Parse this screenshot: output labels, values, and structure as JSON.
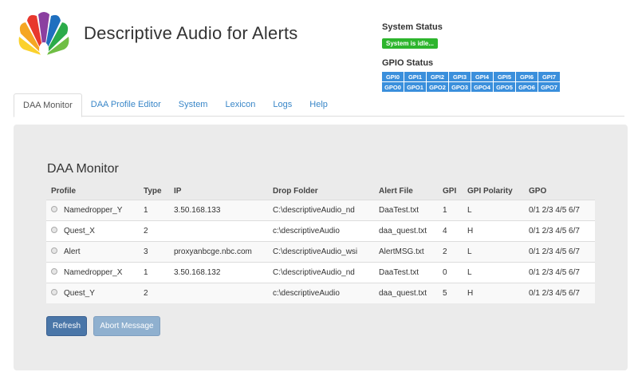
{
  "header": {
    "title": "Descriptive Audio for Alerts",
    "logo_icon": "peacock-logo"
  },
  "system_status": {
    "heading": "System Status",
    "value": "System is idle...",
    "color": "#2db52d"
  },
  "gpio_status": {
    "heading": "GPIO Status",
    "gpi": [
      "GPI0",
      "GPI1",
      "GPI2",
      "GPI3",
      "GPI4",
      "GPI5",
      "GPI6",
      "GPI7"
    ],
    "gpo": [
      "GPO0",
      "GPO1",
      "GPO2",
      "GPO3",
      "GPO4",
      "GPO5",
      "GPO6",
      "GPO7"
    ],
    "color": "#3a8fdc"
  },
  "tabs": [
    {
      "label": "DAA Monitor",
      "active": true
    },
    {
      "label": "DAA Profile Editor",
      "active": false
    },
    {
      "label": "System",
      "active": false
    },
    {
      "label": "Lexicon",
      "active": false
    },
    {
      "label": "Logs",
      "active": false
    },
    {
      "label": "Help",
      "active": false
    }
  ],
  "monitor": {
    "title": "DAA Monitor",
    "columns": [
      "Profile",
      "Type",
      "IP",
      "Drop Folder",
      "Alert File",
      "GPI",
      "GPI Polarity",
      "GPO"
    ],
    "rows": [
      [
        "Namedropper_Y",
        "1",
        "3.50.168.133",
        "C:\\descriptiveAudio_nd",
        "DaaTest.txt",
        "1",
        "L",
        "0/1 2/3 4/5 6/7"
      ],
      [
        "Quest_X",
        "2",
        "",
        "c:\\descriptiveAudio",
        "daa_quest.txt",
        "4",
        "H",
        "0/1 2/3 4/5 6/7"
      ],
      [
        "Alert",
        "3",
        "proxyanbcge.nbc.com",
        "C:\\descriptiveAudio_wsi",
        "AlertMSG.txt",
        "2",
        "L",
        "0/1 2/3 4/5 6/7"
      ],
      [
        "Namedropper_X",
        "1",
        "3.50.168.132",
        "C:\\descriptiveAudio_nd",
        "DaaTest.txt",
        "0",
        "L",
        "0/1 2/3 4/5 6/7"
      ],
      [
        "Quest_Y",
        "2",
        "",
        "c:\\descriptiveAudio",
        "daa_quest.txt",
        "5",
        "H",
        "0/1 2/3 4/5 6/7"
      ]
    ],
    "refresh_label": "Refresh",
    "abort_label": "Abort Message"
  }
}
